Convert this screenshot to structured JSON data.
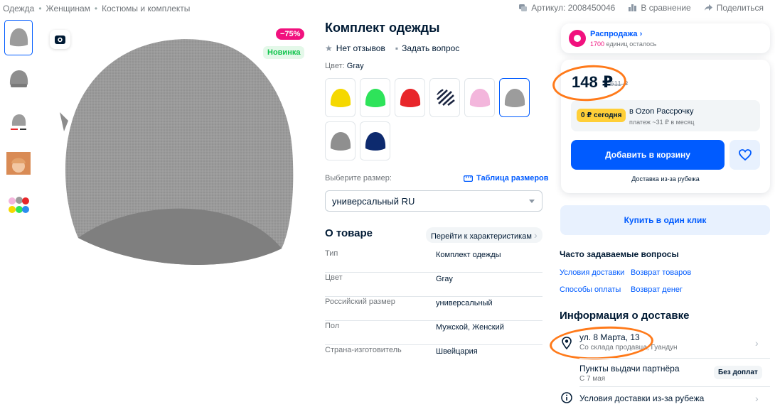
{
  "breadcrumbs": [
    "Одежда",
    "Женщинам",
    "Костюмы и комплекты"
  ],
  "breadcrumb_sep": "•",
  "header": {
    "article": "Артикул: 2008450046",
    "compare": "В сравнение",
    "share": "Поделиться"
  },
  "badges": {
    "discount": "−75%",
    "new": "Новинка"
  },
  "product": {
    "title": "Комплект одежды",
    "reviews": "Нет отзывов",
    "ask": "Задать вопрос",
    "color_label": "Цвет:",
    "color_value": "Gray",
    "swatches": [
      {
        "color": "#f5d800"
      },
      {
        "color": "#2ee35a"
      },
      {
        "color": "#e8262a"
      },
      {
        "color": "striped"
      },
      {
        "color": "#f3b6dc"
      },
      {
        "color": "#9c9c9c",
        "selected": true
      },
      {
        "color": "#8f8f8f"
      },
      {
        "color": "#0d2a6e"
      }
    ],
    "size_label": "Выберите размер:",
    "size_table": "Таблица размеров",
    "size_selected": "универсальный RU"
  },
  "about": {
    "title": "О товаре",
    "goto": "Перейти к характеристикам",
    "specs": [
      {
        "k": "Тип",
        "v": "Комплект одежды"
      },
      {
        "k": "Цвет",
        "v": "Gray"
      },
      {
        "k": "Российский размер",
        "v": "универсальный"
      },
      {
        "k": "Пол",
        "v": "Мужской, Женский"
      },
      {
        "k": "Страна-изготовитель",
        "v": "Швейцария"
      }
    ]
  },
  "sale": {
    "title": "Распродажа",
    "units": "1700",
    "units_rest": "единиц осталось"
  },
  "price": {
    "current": "148 ₽",
    "old": "611 ₽",
    "installment_pill": "0 ₽ сегодня",
    "installment_line1": "в Ozon Рассрочку",
    "installment_line2": "платеж ~31 ₽ в месяц",
    "add_to_cart": "Добавить в корзину",
    "delivery_note": "Доставка из-за рубежа"
  },
  "one_click": "Купить в один клик",
  "faq": {
    "title": "Часто задаваемые вопросы",
    "links": [
      "Условия доставки",
      "Возврат товаров",
      "Способы оплаты",
      "Возврат денег"
    ]
  },
  "delivery": {
    "title": "Информация о доставке",
    "address": "ул. 8 Марта, 13",
    "warehouse": "Со склада продавца, Гуандун",
    "pickup": "Пункты выдачи партнёра",
    "pickup_date": "С 7 мая",
    "free_badge": "Без доплат",
    "conditions": "Условия доставки из-за рубежа"
  },
  "colors": {
    "accent": "#005bff",
    "pink": "#f1117e",
    "annotation": "#ff7a1a"
  }
}
